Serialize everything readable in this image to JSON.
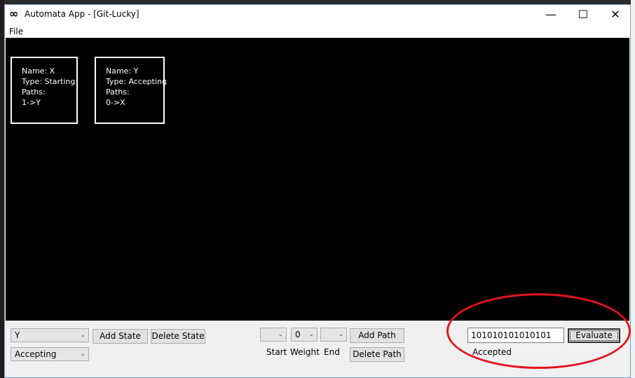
{
  "window": {
    "title": "Automata App - [Git-Lucky]",
    "icon": "infinity-icon",
    "minimize": "—",
    "maximize": "☐",
    "close": "✕"
  },
  "menu": {
    "file": "File"
  },
  "states": [
    {
      "name": "Name: X",
      "type": "Type: Starting",
      "paths_label": "Paths:",
      "paths": "1->Y"
    },
    {
      "name": "Name: Y",
      "type": "Type: Accepting",
      "paths_label": "Paths:",
      "paths": "0->X"
    }
  ],
  "state_panel": {
    "state_select": "Y",
    "type_select": "Accepting",
    "add_state": "Add State",
    "delete_state": "Delete State"
  },
  "path_panel": {
    "start_select": "",
    "weight_select": "0",
    "end_select": "",
    "start_label": "Start",
    "weight_label": "Weight",
    "end_label": "End",
    "add_path": "Add Path",
    "delete_path": "Delete Path"
  },
  "evaluate_panel": {
    "input_value": "101010101010101",
    "evaluate": "Evaluate",
    "result": "Accepted",
    "highlight_color": "#e3141d"
  }
}
